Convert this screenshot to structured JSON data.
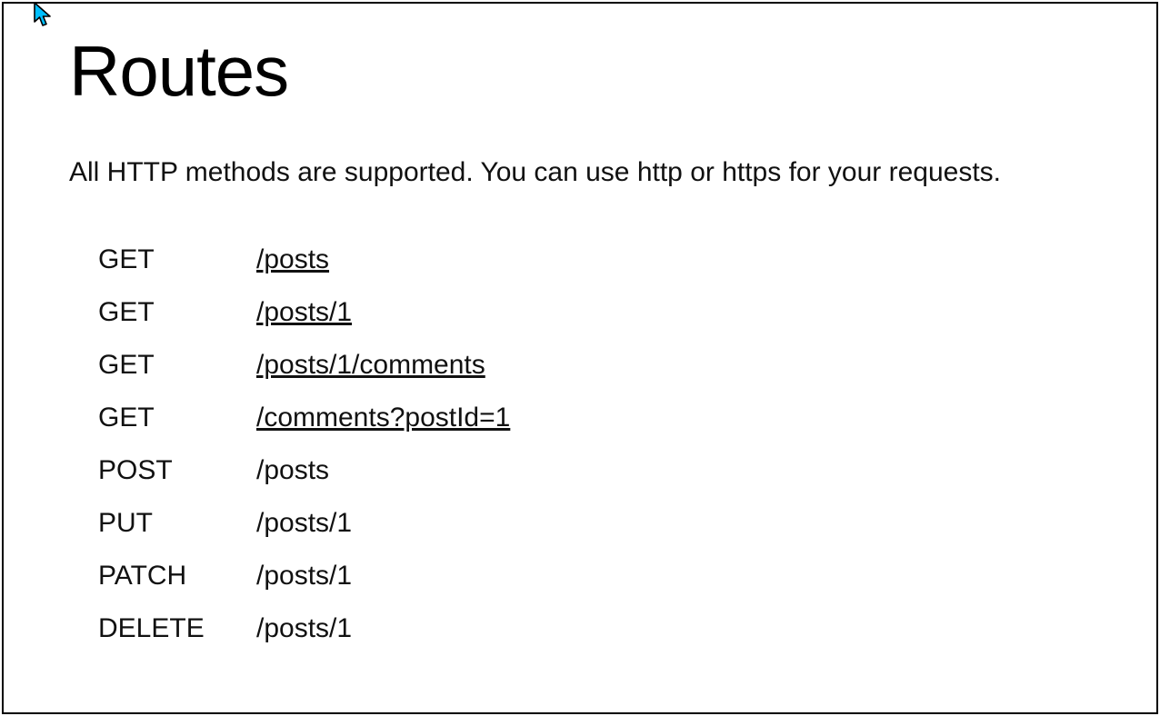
{
  "title": "Routes",
  "description": "All HTTP methods are supported. You can use http or https for your requests.",
  "routes": [
    {
      "method": "GET",
      "path": "/posts",
      "link": true
    },
    {
      "method": "GET",
      "path": "/posts/1",
      "link": true
    },
    {
      "method": "GET",
      "path": "/posts/1/comments",
      "link": true
    },
    {
      "method": "GET",
      "path": "/comments?postId=1",
      "link": true
    },
    {
      "method": "POST",
      "path": "/posts",
      "link": false
    },
    {
      "method": "PUT",
      "path": "/posts/1",
      "link": false
    },
    {
      "method": "PATCH",
      "path": "/posts/1",
      "link": false
    },
    {
      "method": "DELETE",
      "path": "/posts/1",
      "link": false
    }
  ]
}
